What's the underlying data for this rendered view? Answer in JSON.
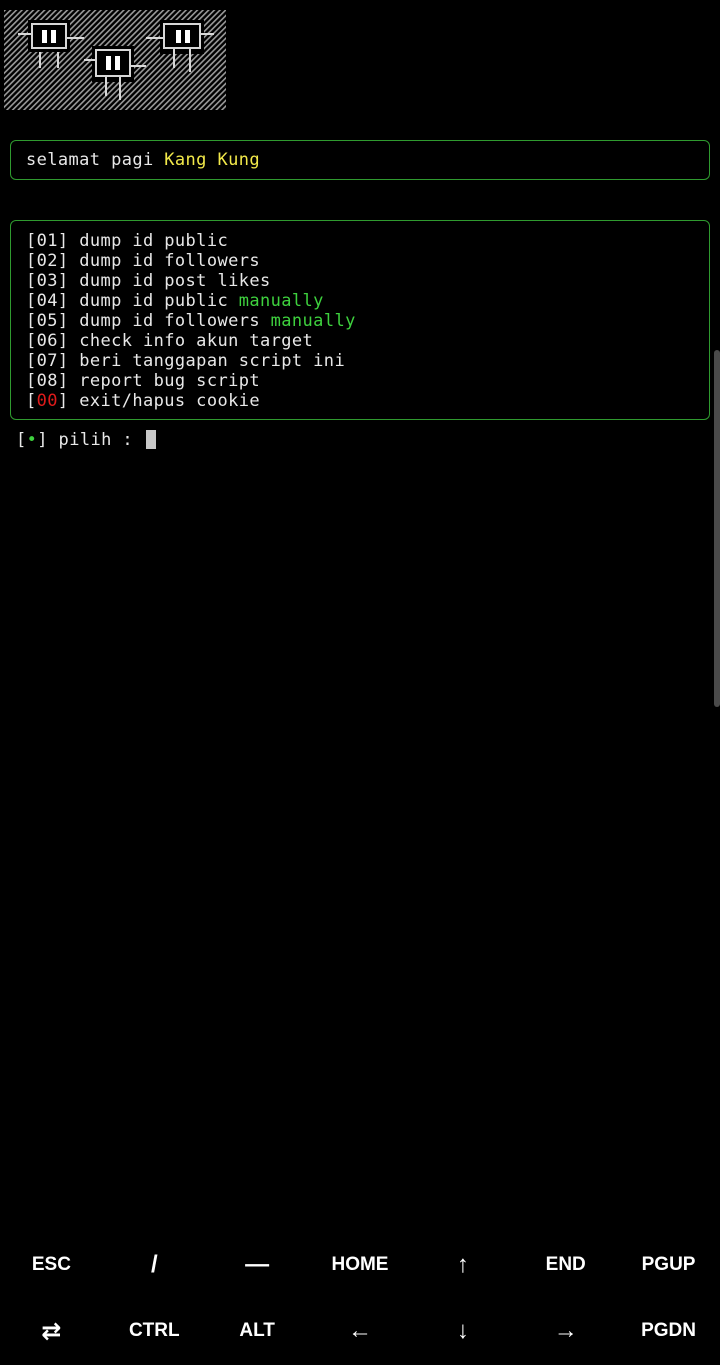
{
  "logo": {
    "icon": "ascii-robots-logo"
  },
  "greeting": {
    "prefix": "selamat pagi ",
    "name": "Kang Kung"
  },
  "menu": {
    "items": [
      {
        "num": "01",
        "text": "dump id public",
        "suffix": ""
      },
      {
        "num": "02",
        "text": "dump id followers",
        "suffix": ""
      },
      {
        "num": "03",
        "text": "dump id post likes",
        "suffix": ""
      },
      {
        "num": "04",
        "text": "dump id public ",
        "suffix": "manually"
      },
      {
        "num": "05",
        "text": "dump id followers ",
        "suffix": "manually"
      },
      {
        "num": "06",
        "text": "check info akun target",
        "suffix": ""
      },
      {
        "num": "07",
        "text": "beri tanggapan script ini",
        "suffix": ""
      },
      {
        "num": "08",
        "text": "report bug script",
        "suffix": ""
      },
      {
        "num": "00",
        "text": "exit/hapus cookie",
        "suffix": ""
      }
    ]
  },
  "prompt": {
    "open": "[",
    "dot": "•",
    "close": "]",
    "label": " pilih : "
  },
  "extra_keys": {
    "row1": [
      "ESC",
      "/",
      "—",
      "HOME",
      "↑",
      "END",
      "PGUP"
    ],
    "row2": [
      "⇄",
      "CTRL",
      "ALT",
      "←",
      "↓",
      "→",
      "PGDN"
    ]
  },
  "colors": {
    "border": "#2f9a2f",
    "name": "#f2e94a",
    "accent_green": "#3ed13e",
    "exit_red": "#e01b1b"
  }
}
